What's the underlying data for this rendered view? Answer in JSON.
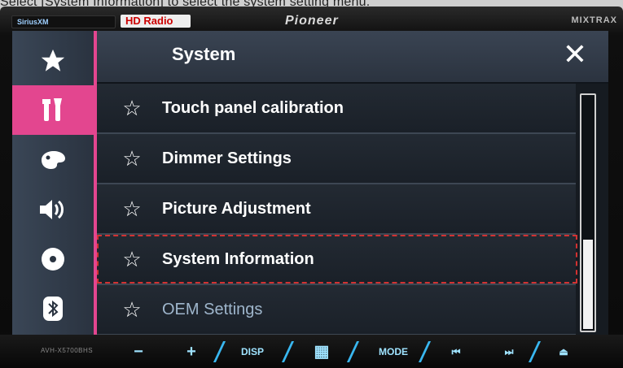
{
  "caption": "Select [System Information] to select the system setting  menu.",
  "device": {
    "brand": "Pioneer",
    "badge_sxm": "SiriusXM",
    "badge_hd": "HD Radio",
    "mixtrax": "MIXTRAX",
    "model": "AVH-X5700BHS"
  },
  "sidebar": {
    "items": [
      {
        "icon": "star-icon"
      },
      {
        "icon": "tools-icon",
        "active": true
      },
      {
        "icon": "theme-icon"
      },
      {
        "icon": "speaker-icon"
      },
      {
        "icon": "disc-icon"
      },
      {
        "icon": "bluetooth-icon"
      }
    ]
  },
  "header": {
    "title": "System",
    "close_label": "✕"
  },
  "menu": {
    "items": [
      {
        "label": "Touch panel calibration"
      },
      {
        "label": "Dimmer Settings"
      },
      {
        "label": "Picture Adjustment"
      },
      {
        "label": "System Information",
        "highlighted": true
      },
      {
        "label": "OEM Settings",
        "dimmed": true
      }
    ],
    "star_glyph": "☆"
  },
  "hardware_buttons": {
    "minus": "−",
    "plus": "+",
    "disp": "DISP",
    "home": "▦",
    "mode": "MODE",
    "prev": "⏮",
    "next": "⏭",
    "eject": "⏏"
  },
  "colors": {
    "accent": "#e3468f",
    "highlight_border": "#d23232"
  }
}
